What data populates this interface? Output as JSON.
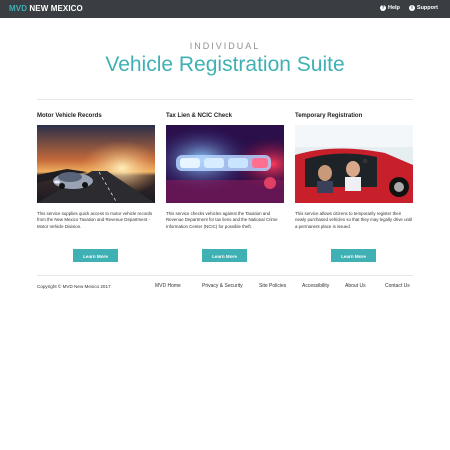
{
  "topbar": {
    "brand_prefix": "MVD",
    "brand_suffix": "NEW MEXICO",
    "help_label": "Help",
    "support_label": "Support"
  },
  "hero": {
    "eyebrow": "INDIVIDUAL",
    "title": "Vehicle Registration Suite"
  },
  "cards": [
    {
      "title": "Motor Vehicle Records",
      "text": "This service supplies quick access to motor vehicle records from the New Mexico Taxation and Revenue Department - Motor Vehicle Division.",
      "button": "Learn More"
    },
    {
      "title": "Tax Lien & NCIC Check",
      "text": "This service checks vehicles against the Taxation and Revenue Department for tax liens and the National Crime Information Center (NCIC) for possible theft.",
      "button": "Learn More"
    },
    {
      "title": "Temporary Registration",
      "text": "This service allows citizens to temporarily register their newly purchased vehicles so that they may legally drive until a permanent place is issued.",
      "button": "Learn More"
    }
  ],
  "footer": {
    "copyright": "Copyright © MVD New Mexico 2017",
    "links": [
      "MVD Home",
      "Privacy & Security",
      "Site Policies",
      "Accessibility",
      "About Us",
      "Contact Us"
    ]
  },
  "colors": {
    "accent": "#3fb0b3",
    "topbar": "#3a3d42"
  }
}
